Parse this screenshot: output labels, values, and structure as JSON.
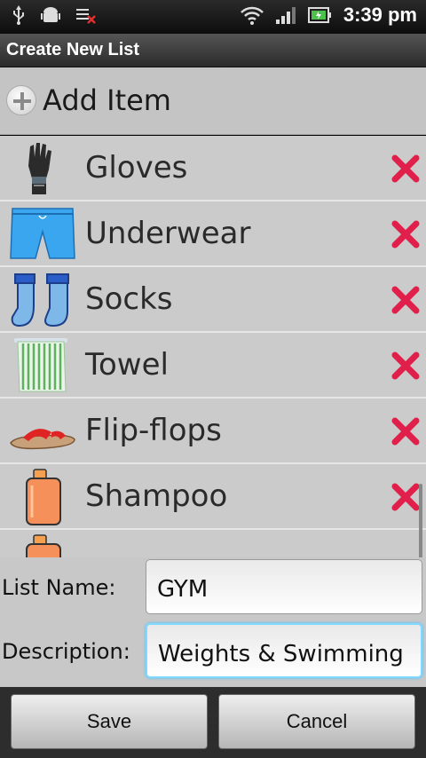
{
  "status_bar": {
    "time": "3:39 pm",
    "left_icons": [
      "usb-icon",
      "android-debug-icon",
      "wifi-debug-icon"
    ],
    "right_icons": [
      "wifi-icon",
      "signal-icon",
      "battery-icon"
    ]
  },
  "title": "Create New List",
  "add_item_label": "Add Item",
  "items": [
    {
      "name": "Gloves",
      "icon": "gloves-icon"
    },
    {
      "name": "Underwear",
      "icon": "shorts-icon"
    },
    {
      "name": "Socks",
      "icon": "socks-icon"
    },
    {
      "name": "Towel",
      "icon": "towel-icon"
    },
    {
      "name": "Flip-flops",
      "icon": "sandal-icon"
    },
    {
      "name": "Shampoo",
      "icon": "shampoo-icon"
    }
  ],
  "form": {
    "list_name_label": "List Name:",
    "list_name_value": "GYM",
    "description_label": "Description:",
    "description_value": "Weights & Swimming"
  },
  "buttons": {
    "save": "Save",
    "cancel": "Cancel"
  },
  "colors": {
    "delete_red": "#e0204a",
    "focus_blue": "#7fd8ff",
    "list_bg": "#cbcbcb"
  }
}
